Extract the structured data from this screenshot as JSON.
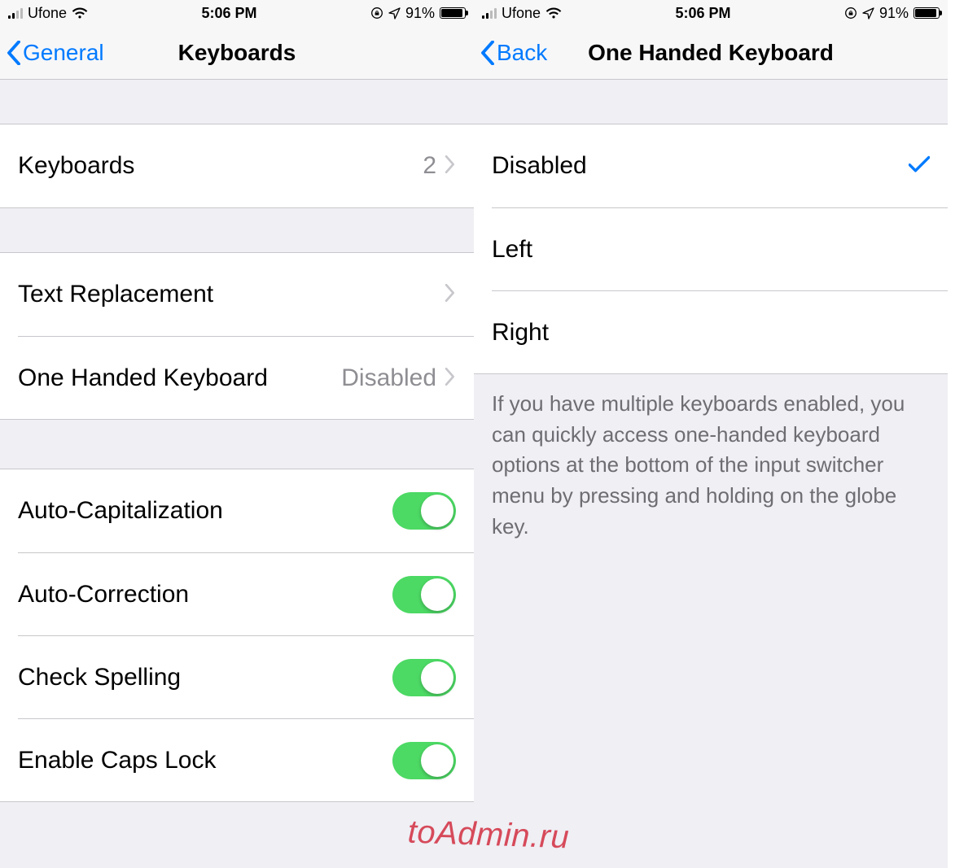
{
  "status": {
    "carrier": "Ufone",
    "time": "5:06 PM",
    "battery_pct": "91%"
  },
  "left": {
    "back_label": "General",
    "title": "Keyboards",
    "keyboards_row": {
      "label": "Keyboards",
      "value": "2"
    },
    "text_replacement": "Text Replacement",
    "one_handed": {
      "label": "One Handed Keyboard",
      "value": "Disabled"
    },
    "toggles": {
      "auto_cap": "Auto-Capitalization",
      "auto_corr": "Auto-Correction",
      "check_spell": "Check Spelling",
      "caps_lock": "Enable Caps Lock"
    }
  },
  "right": {
    "back_label": "Back",
    "title": "One Handed Keyboard",
    "options": {
      "disabled": "Disabled",
      "left": "Left",
      "right": "Right"
    },
    "footer": "If you have multiple keyboards enabled, you can quickly access one-handed keyboard options at the bottom of the input switcher menu by pressing and holding on the globe key."
  },
  "watermark": "toAdmin.ru"
}
